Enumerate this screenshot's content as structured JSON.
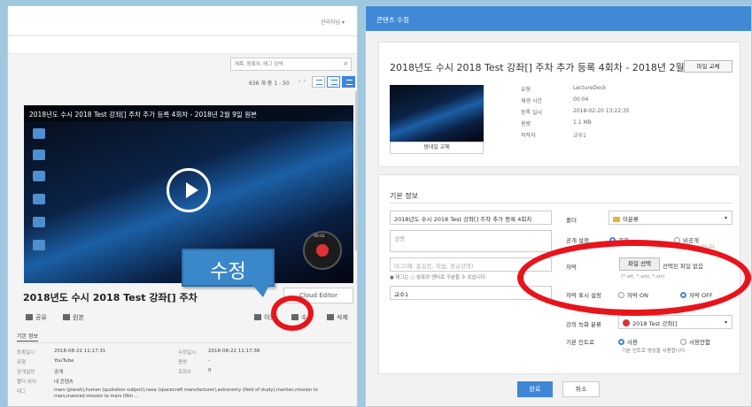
{
  "left": {
    "user_menu": "관리자님 ▾",
    "search_placeholder": "제목, 등록자, 태그 검색",
    "count_text": "636 개 중 1 - 50",
    "prev": "‹",
    "next": "›",
    "video_title": "2018년도 수시 2018 Test 강좌[] 주차 추가 등록 4회차 - 2018년 2월 9일 원본",
    "rec_time": "00:01",
    "content_title": "2018년도 수시 2018 Test 강좌[] 주차",
    "cloud_editor": "Cloud Editor",
    "actions": {
      "share": "공유",
      "original": "원본",
      "move": "이동",
      "edit": "수정",
      "delete": "삭제"
    },
    "tab_basic": "기본 정보",
    "info": [
      {
        "label": "등록일시",
        "value": "2018-08-22 11:17:31",
        "label2": "수정일시",
        "value2": "2018-08-22 11:17:38"
      },
      {
        "label": "유형",
        "value": "YouTube",
        "label2": "용량",
        "value2": "-"
      },
      {
        "label": "공개설정",
        "value": "공개",
        "label2": "조회수",
        "value2": "0"
      },
      {
        "label": "폴더 위치",
        "value": "내 콘텐츠",
        "label2": "",
        "value2": ""
      },
      {
        "label": "태그",
        "value": "mars (planet),human (quotation subject),nasa (spacecraft manufacturer),astronomy (field of study),martian,mission to mars,manned mission to mars (film ...",
        "label2": "",
        "value2": ""
      }
    ]
  },
  "callout": {
    "text": "수정"
  },
  "right": {
    "header_title": "콘텐츠 수정",
    "content_title": "2018년도 수시 2018 Test 강좌[] 주차 추가 등록 4회차 - 2018년 2월 9일",
    "replace_file": "파일 교체",
    "replace_thumbnail": "썸네일 교체",
    "meta": [
      {
        "label": "유형",
        "value": "LectureDeck"
      },
      {
        "label": "재생 시간",
        "value": "00:04"
      },
      {
        "label": "등록 일시",
        "value": "2018-02-20 13:22:35"
      },
      {
        "label": "용량",
        "value": "1.1 MB"
      },
      {
        "label": "저작자",
        "value": "교수1"
      }
    ],
    "section_title": "기본 정보",
    "title_value": "2018년도 수시 2018 Test 강좌[] 주차 추가 등록 4회차",
    "desc_placeholder": "설명",
    "tags_placeholder": "태그(예: 홍길동, 학습, 정규강의)",
    "tag_hint": "● 태그는 ○ 쉼표와 엔터로 구분할 수 있습니다.",
    "author_value": "교수1",
    "folder_label": "폴더",
    "folder_value": "미분류",
    "public_label": "공개 설정",
    "public_on": "공개",
    "public_off": "비공개",
    "private_note": "...할 수 있습니다.",
    "subtitle_label": "자막",
    "file_select": "파일 선택",
    "no_file": "선택된 파일 없음",
    "file_types": "(*.vtt, *.smi, *.srt)",
    "subtitle_display_label": "자막 표시 설정",
    "sub_on": "자막 ON",
    "sub_off": "자막 OFF",
    "lecture_label": "강의 녹화 분류",
    "lecture_value": "2018 Test 강좌[]",
    "intro_label": "기본 인트로",
    "intro_use": "사용",
    "intro_nouse": "사용안함",
    "intro_note": "기본 인트로 영상을 사용합니다.",
    "done": "완료",
    "cancel": "취소"
  },
  "colors": {
    "accent": "#3f86d6",
    "highlight": "#e8141b",
    "backdrop": "#9fc8de"
  }
}
